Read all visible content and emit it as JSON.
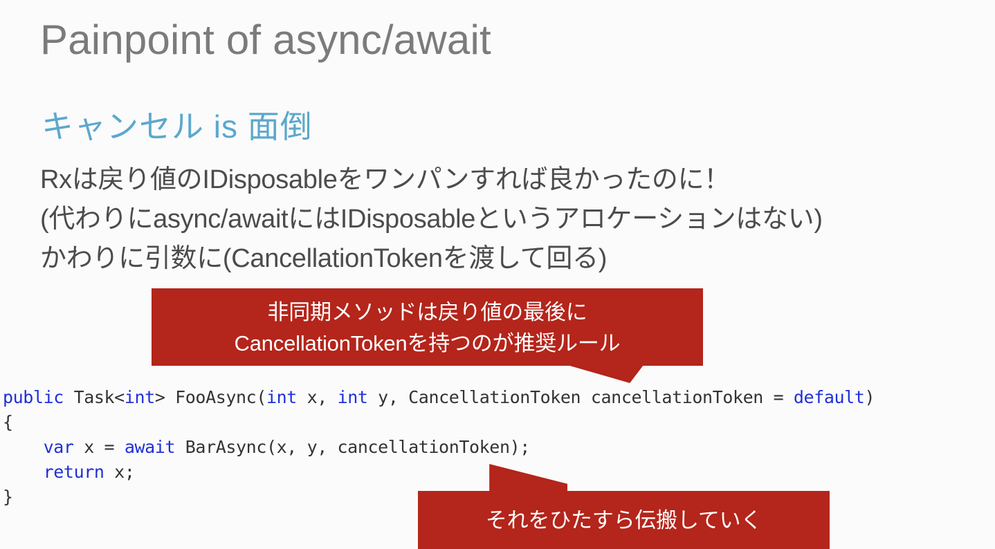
{
  "slide": {
    "title": "Painpoint of async/await",
    "subtitle": "キャンセル is 面倒",
    "body_lines": [
      "Rxは戻り値のIDisposableをワンパンすれば良かったのに！",
      "(代わりにasync/awaitにはIDisposableというアロケーションはない)",
      "かわりに引数に(CancellationTokenを渡して回る)"
    ]
  },
  "code": {
    "language": "csharp",
    "lines": [
      [
        {
          "t": "public",
          "k": true
        },
        {
          "t": " Task<",
          "k": false
        },
        {
          "t": "int",
          "k": true
        },
        {
          "t": "> FooAsync(",
          "k": false
        },
        {
          "t": "int",
          "k": true
        },
        {
          "t": " x, ",
          "k": false
        },
        {
          "t": "int",
          "k": true
        },
        {
          "t": " y, CancellationToken cancellationToken = ",
          "k": false
        },
        {
          "t": "default",
          "k": true
        },
        {
          "t": ")",
          "k": false
        }
      ],
      [
        {
          "t": "{",
          "k": false
        }
      ],
      [
        {
          "t": "    ",
          "k": false
        },
        {
          "t": "var",
          "k": true
        },
        {
          "t": " x = ",
          "k": false
        },
        {
          "t": "await",
          "k": true
        },
        {
          "t": " BarAsync(x, y, cancellationToken);",
          "k": false
        }
      ],
      [
        {
          "t": "    ",
          "k": false
        },
        {
          "t": "return",
          "k": true
        },
        {
          "t": " x;",
          "k": false
        }
      ],
      [
        {
          "t": "}",
          "k": false
        }
      ]
    ]
  },
  "callouts": {
    "one": {
      "lines": [
        "非同期メソッドは戻り値の最後に",
        "CancellationTokenを持つのが推奨ルール"
      ]
    },
    "two": {
      "lines": [
        "それをひたすら伝搬していく"
      ]
    }
  },
  "colors": {
    "background": "#fbfbfb",
    "title": "#7b7b7b",
    "subtitle_accent": "#5ba8cc",
    "body_text": "#4c4c4c",
    "callout_red": "#b4251b",
    "code_keyword": "#2030d8",
    "code_text": "#333333"
  }
}
